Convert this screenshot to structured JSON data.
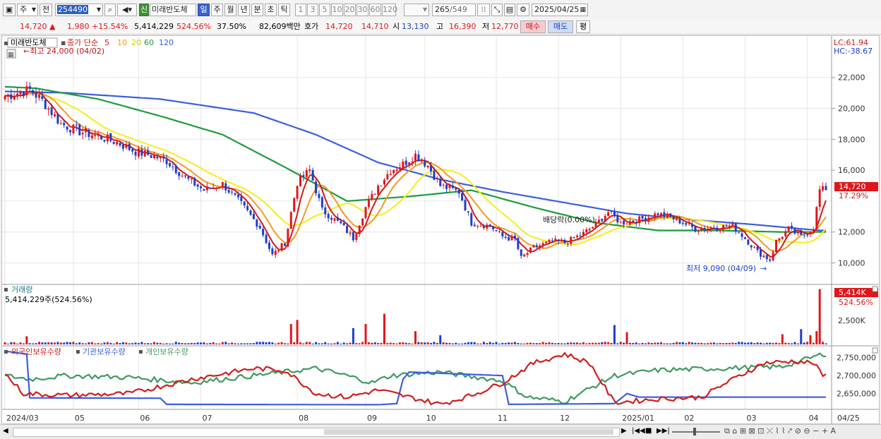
{
  "toolbar": {
    "type_selector": "주",
    "prev_label": "전",
    "code": "254490",
    "shin_label": "신",
    "stock_name": "미래반도체",
    "periods": [
      "일",
      "주",
      "월",
      "년",
      "분",
      "초",
      "틱"
    ],
    "active_period": "일",
    "intervals": [
      "1",
      "3",
      "5",
      "10",
      "20",
      "30",
      "60",
      "120"
    ],
    "count": "265",
    "total": "/549",
    "date": "2025/04/25"
  },
  "pricebar": {
    "price": "14,720",
    "change": "1,980",
    "change_pct": "+15.54%",
    "volume": "5,414,229",
    "volume_ratio": "524.56%",
    "turnover": "37.50%",
    "amount": "82,609백만",
    "quote_label": "호가",
    "ask": "14,720",
    "bid": "14,710",
    "open_label": "시",
    "open": "13,130",
    "high_label": "고",
    "high": "16,390",
    "low_label": "저",
    "low": "12,770",
    "buy_label": "매수",
    "sell_label": "매도",
    "eval_label": "평"
  },
  "colors": {
    "up": "#e0161b",
    "down": "#1d3fc9",
    "ma5": "#d71818",
    "ma10": "#f39a20",
    "ma20": "#f4ee1a",
    "ma60": "#1f9b3b",
    "ma120": "#3a5ee0",
    "foreign": "#d01f1f",
    "inst": "#3a5ee0",
    "retail": "#3f9a5f"
  },
  "price_panel": {
    "name": "미래반도체",
    "legend_prefix": "종가 단순",
    "ma_periods": [
      "5",
      "10",
      "20",
      "60",
      "120"
    ],
    "max_label": "←최고 24,000 (04/02)",
    "min_label": "최저 9,090 (04/09)",
    "dividend_label": "배당락(0.00%)",
    "lc_label": "LC:61.94",
    "hc_label": "HC:-38.67",
    "current_price_tag": "14,720",
    "current_pct_tag": "17.29%",
    "y_ticks": [
      "22,000",
      "20,000",
      "18,000",
      "16,000",
      "12,000",
      "10,000"
    ]
  },
  "volume_panel": {
    "title": "거래량",
    "value_label": "5,414,229주(524.56%)",
    "tag": "5,414K",
    "tag_pct": "524.56%",
    "y_tick": "2,500K"
  },
  "holdings_panel": {
    "legend": [
      "외국인보유수량",
      "기관보유수량",
      "개인보유수량"
    ],
    "y_ticks": [
      "2,750,000",
      "2,700,000",
      "2,650,000"
    ]
  },
  "x_axis": {
    "labels": [
      "2024/03",
      "05",
      "06",
      "07",
      "08",
      "09",
      "10",
      "11",
      "12",
      "2025/01",
      "02",
      "03",
      "04",
      "04/25"
    ]
  },
  "chart_data": {
    "type": "candlestick",
    "price_range": [
      8700,
      24500
    ],
    "volume_range": [
      0,
      5600000
    ],
    "holdings_range": [
      2610000,
      2775000
    ],
    "price_keypoints": [
      [
        0,
        20800
      ],
      [
        8,
        21200
      ],
      [
        12,
        20500
      ],
      [
        18,
        19000
      ],
      [
        24,
        18500
      ],
      [
        30,
        18200
      ],
      [
        36,
        17800
      ],
      [
        42,
        17200
      ],
      [
        48,
        16900
      ],
      [
        52,
        16600
      ],
      [
        58,
        15500
      ],
      [
        64,
        14700
      ],
      [
        70,
        15100
      ],
      [
        76,
        13800
      ],
      [
        82,
        12300
      ],
      [
        86,
        10500
      ],
      [
        90,
        11300
      ],
      [
        94,
        15200
      ],
      [
        98,
        16000
      ],
      [
        102,
        13400
      ],
      [
        108,
        12500
      ],
      [
        112,
        11600
      ],
      [
        116,
        13600
      ],
      [
        120,
        15000
      ],
      [
        124,
        16000
      ],
      [
        128,
        16400
      ],
      [
        132,
        17000
      ],
      [
        136,
        16300
      ],
      [
        140,
        15000
      ],
      [
        146,
        14600
      ],
      [
        150,
        12600
      ],
      [
        156,
        12400
      ],
      [
        160,
        11700
      ],
      [
        164,
        11500
      ],
      [
        166,
        10300
      ],
      [
        170,
        11000
      ],
      [
        176,
        11400
      ],
      [
        180,
        11300
      ],
      [
        186,
        11900
      ],
      [
        190,
        12500
      ],
      [
        194,
        13300
      ],
      [
        198,
        12600
      ],
      [
        204,
        12800
      ],
      [
        210,
        13200
      ],
      [
        216,
        12800
      ],
      [
        222,
        12200
      ],
      [
        228,
        12300
      ],
      [
        234,
        12400
      ],
      [
        238,
        11600
      ],
      [
        242,
        10700
      ],
      [
        246,
        10200
      ],
      [
        248,
        11400
      ],
      [
        252,
        12200
      ],
      [
        256,
        11700
      ],
      [
        260,
        12300
      ],
      [
        262,
        14720
      ]
    ],
    "ma_keypoints": {
      "ma60": [
        [
          0,
          21400
        ],
        [
          10,
          21300
        ],
        [
          30,
          20600
        ],
        [
          50,
          19500
        ],
        [
          70,
          18300
        ],
        [
          90,
          16200
        ],
        [
          110,
          14000
        ],
        [
          130,
          14300
        ],
        [
          150,
          14700
        ],
        [
          170,
          13600
        ],
        [
          190,
          12600
        ],
        [
          210,
          12100
        ],
        [
          230,
          12100
        ],
        [
          250,
          12000
        ],
        [
          262,
          12000
        ]
      ],
      "ma120": [
        [
          0,
          21100
        ],
        [
          20,
          21000
        ],
        [
          50,
          20600
        ],
        [
          80,
          19700
        ],
        [
          100,
          18300
        ],
        [
          120,
          16500
        ],
        [
          140,
          15400
        ],
        [
          160,
          14600
        ],
        [
          180,
          13900
        ],
        [
          200,
          13200
        ],
        [
          220,
          12800
        ],
        [
          240,
          12500
        ],
        [
          262,
          12100
        ]
      ]
    },
    "volume_spikes": [
      [
        7,
        800000
      ],
      [
        92,
        2000000
      ],
      [
        94,
        2400000
      ],
      [
        112,
        1600000
      ],
      [
        116,
        2000000
      ],
      [
        122,
        3000000
      ],
      [
        132,
        1300000
      ],
      [
        140,
        900000
      ],
      [
        196,
        1900000
      ],
      [
        200,
        1200000
      ],
      [
        250,
        1000000
      ],
      [
        256,
        1500000
      ],
      [
        259,
        900000
      ],
      [
        261,
        1300000
      ],
      [
        262,
        5414229
      ]
    ],
    "holdings_keypoints": {
      "foreign": [
        [
          0,
          2705000
        ],
        [
          6,
          2650000
        ],
        [
          20,
          2645000
        ],
        [
          40,
          2650000
        ],
        [
          60,
          2690000
        ],
        [
          80,
          2720000
        ],
        [
          90,
          2715000
        ],
        [
          100,
          2650000
        ],
        [
          110,
          2640000
        ],
        [
          120,
          2660000
        ],
        [
          130,
          2640000
        ],
        [
          140,
          2620000
        ],
        [
          150,
          2645000
        ],
        [
          160,
          2680000
        ],
        [
          170,
          2735000
        ],
        [
          180,
          2760000
        ],
        [
          188,
          2735000
        ],
        [
          196,
          2625000
        ],
        [
          210,
          2635000
        ],
        [
          224,
          2640000
        ],
        [
          232,
          2680000
        ],
        [
          244,
          2735000
        ],
        [
          254,
          2740000
        ],
        [
          260,
          2735000
        ],
        [
          263,
          2700000
        ]
      ],
      "inst": [
        [
          0,
          2768000
        ],
        [
          7,
          2760000
        ],
        [
          8,
          2638000
        ],
        [
          50,
          2637000
        ],
        [
          52,
          2620000
        ],
        [
          120,
          2619000
        ],
        [
          126,
          2622000
        ],
        [
          128,
          2690000
        ],
        [
          130,
          2710000
        ],
        [
          160,
          2700000
        ],
        [
          162,
          2620000
        ],
        [
          196,
          2622000
        ],
        [
          200,
          2650000
        ],
        [
          204,
          2640000
        ],
        [
          263,
          2640000
        ]
      ],
      "retail": [
        [
          0,
          2700000
        ],
        [
          8,
          2690000
        ],
        [
          20,
          2700000
        ],
        [
          40,
          2695000
        ],
        [
          60,
          2680000
        ],
        [
          80,
          2700000
        ],
        [
          100,
          2720000
        ],
        [
          110,
          2700000
        ],
        [
          118,
          2680000
        ],
        [
          124,
          2700000
        ],
        [
          140,
          2710000
        ],
        [
          160,
          2685000
        ],
        [
          168,
          2640000
        ],
        [
          180,
          2628000
        ],
        [
          196,
          2700000
        ],
        [
          210,
          2715000
        ],
        [
          230,
          2720000
        ],
        [
          250,
          2725000
        ],
        [
          263,
          2760000
        ]
      ]
    }
  }
}
